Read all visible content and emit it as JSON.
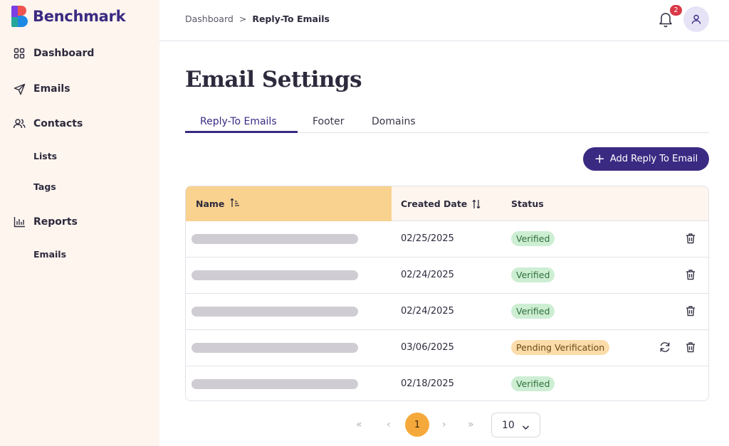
{
  "brand": {
    "name": "Benchmark"
  },
  "sidebar": {
    "items": [
      {
        "label": "Dashboard",
        "icon": "grid-icon"
      },
      {
        "label": "Emails",
        "icon": "send-icon"
      },
      {
        "label": "Contacts",
        "icon": "users-icon"
      },
      {
        "label": "Reports",
        "icon": "bar-chart-icon"
      }
    ],
    "contacts_sub": [
      "Lists",
      "Tags"
    ],
    "reports_sub": [
      "Emails"
    ]
  },
  "header": {
    "breadcrumb": [
      "Dashboard",
      "Reply-To Emails"
    ],
    "breadcrumb_sep": ">",
    "notification_count": "2"
  },
  "main": {
    "title": "Email Settings",
    "tabs": [
      {
        "label": "Reply-To Emails",
        "active": true
      },
      {
        "label": "Footer",
        "active": false
      },
      {
        "label": "Domains",
        "active": false
      }
    ],
    "add_button_label": "Add Reply To Email"
  },
  "table": {
    "columns": [
      "Name",
      "Created Date",
      "Status"
    ],
    "rows": [
      {
        "created": "02/25/2025",
        "status": "Verified",
        "actions": [
          "delete"
        ]
      },
      {
        "created": "02/24/2025",
        "status": "Verified",
        "actions": [
          "delete"
        ]
      },
      {
        "created": "02/24/2025",
        "status": "Verified",
        "actions": [
          "delete"
        ]
      },
      {
        "created": "03/06/2025",
        "status": "Pending Verification",
        "actions": [
          "refresh",
          "delete"
        ]
      },
      {
        "created": "02/18/2025",
        "status": "Verified",
        "actions": []
      }
    ]
  },
  "pagination": {
    "first": "«",
    "prev": "‹",
    "current_page": "1",
    "next": "›",
    "last": "»",
    "page_size": "10"
  },
  "colors": {
    "brand": "#3b2a82",
    "sidebar_bg": "#fdf5ee",
    "active_sort_header": "#f9d28f",
    "verified_bg": "#cdeed3",
    "pending_bg": "#fbdcaa",
    "current_page": "#f6a93b",
    "notification_badge": "#d93848"
  }
}
